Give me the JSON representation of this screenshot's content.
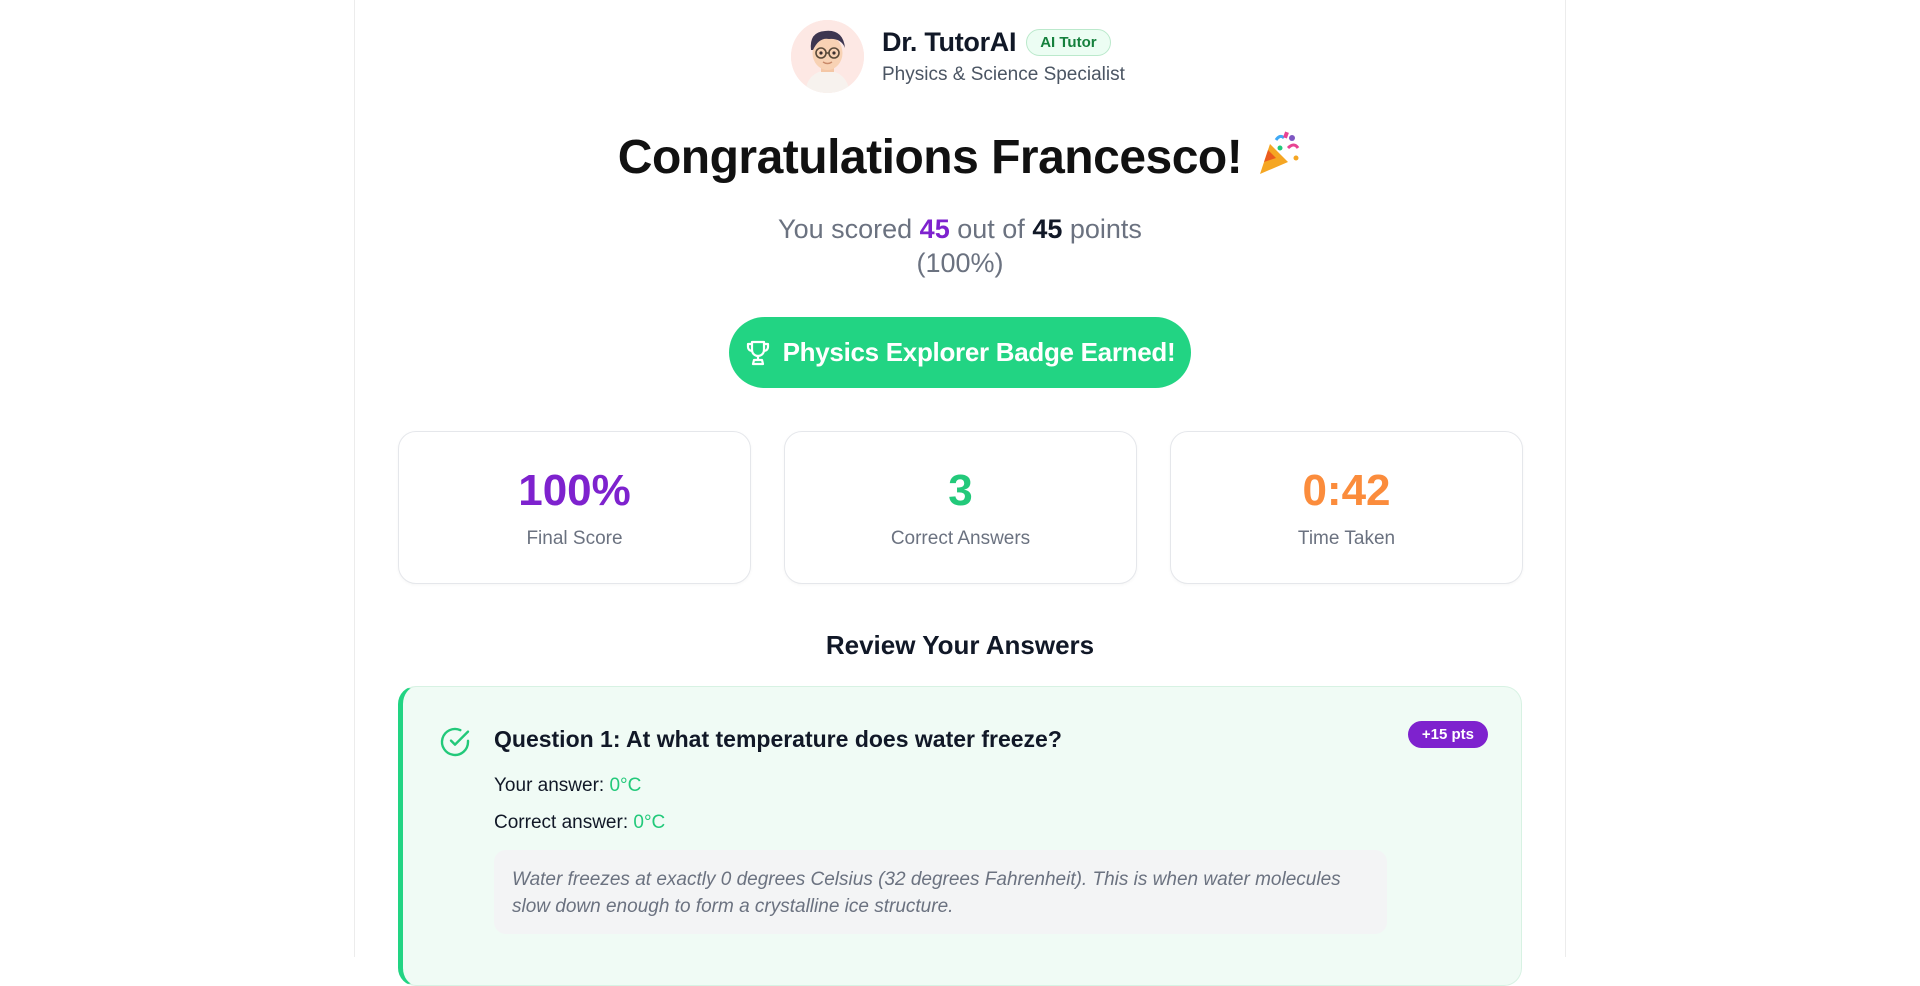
{
  "tutor": {
    "name": "Dr. TutorAI",
    "badge": "AI Tutor",
    "subtitle": "Physics & Science Specialist",
    "avatar_icon": "tutor-avatar"
  },
  "result": {
    "heading": "Congratulations Francesco!",
    "heading_icon": "party-popper-icon",
    "score_prefix": "You scored",
    "score": "45",
    "score_mid": "out of",
    "total": "45",
    "score_suffix": "points",
    "percent_text": "(100%)"
  },
  "badge_button": {
    "label": "Physics Explorer Badge Earned!",
    "icon": "trophy-icon",
    "color": "#22d483"
  },
  "stats": [
    {
      "value": "100%",
      "label": "Final Score",
      "color": "#7e22ce"
    },
    {
      "value": "3",
      "label": "Correct Answers",
      "color": "#22c97a"
    },
    {
      "value": "0:42",
      "label": "Time Taken",
      "color": "#fb8c3c"
    }
  ],
  "review": {
    "title": "Review Your Answers",
    "questions": [
      {
        "title": "Question 1: At what temperature does water freeze?",
        "points": "+15 pts",
        "your_answer_label": "Your answer:",
        "your_answer": "0°C",
        "correct_answer_label": "Correct answer:",
        "correct_answer": "0°C",
        "explanation": "Water freezes at exactly 0 degrees Celsius (32 degrees Fahrenheit). This is when water molecules slow down enough to form a crystalline ice structure.",
        "status_icon": "check-circle-icon"
      }
    ]
  }
}
